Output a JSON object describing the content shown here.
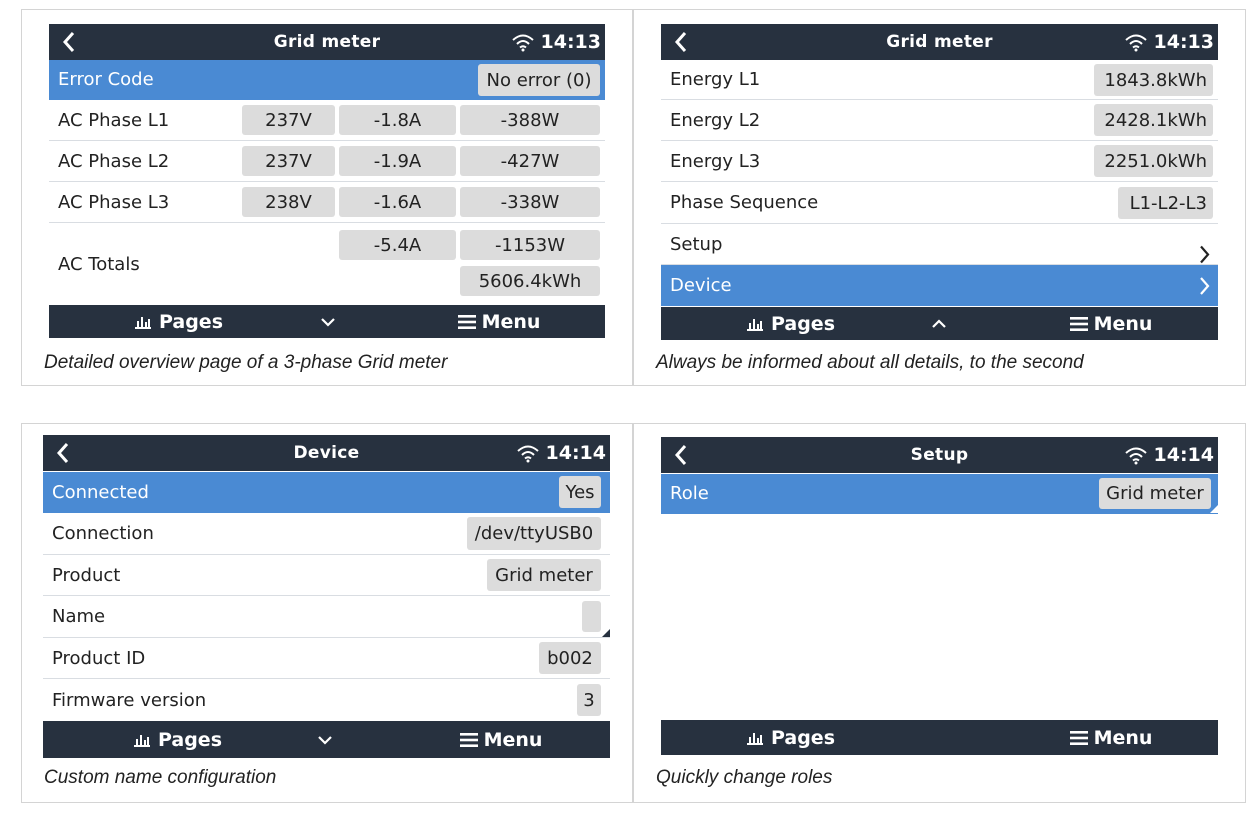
{
  "panels": {
    "p1": {
      "title": "Grid meter",
      "time": "14:13",
      "error": {
        "label": "Error Code",
        "value": "No error (0)"
      },
      "phases": [
        {
          "label": "AC Phase L1",
          "v": "237V",
          "a": "-1.8A",
          "w": "-388W"
        },
        {
          "label": "AC Phase L2",
          "v": "237V",
          "a": "-1.9A",
          "w": "-427W"
        },
        {
          "label": "AC Phase L3",
          "v": "238V",
          "a": "-1.6A",
          "w": "-338W"
        }
      ],
      "totals": {
        "label": "AC Totals",
        "a": "-5.4A",
        "w": "-1153W",
        "kwh": "5606.4kWh"
      },
      "nav": {
        "pages": "Pages",
        "menu": "Menu"
      },
      "caption": "Detailed overview page of a 3-phase Grid meter"
    },
    "p2": {
      "title": "Grid meter",
      "time": "14:13",
      "rows": [
        {
          "label": "Energy L1",
          "value": "1843.8kWh"
        },
        {
          "label": "Energy L2",
          "value": "2428.1kWh"
        },
        {
          "label": "Energy L3",
          "value": "2251.0kWh"
        },
        {
          "label": "Phase Sequence",
          "value": "L1-L2-L3"
        }
      ],
      "setup": "Setup",
      "device": "Device",
      "nav": {
        "pages": "Pages",
        "menu": "Menu"
      },
      "caption": "Always be informed about all details, to the second"
    },
    "p3": {
      "title": "Device",
      "time": "14:14",
      "rows": [
        {
          "label": "Connected",
          "value": "Yes"
        },
        {
          "label": "Connection",
          "value": "/dev/ttyUSB0"
        },
        {
          "label": "Product",
          "value": "Grid meter"
        },
        {
          "label": "Name",
          "value": ""
        },
        {
          "label": "Product ID",
          "value": "b002"
        },
        {
          "label": "Firmware version",
          "value": "3"
        }
      ],
      "nav": {
        "pages": "Pages",
        "menu": "Menu"
      },
      "caption": "Custom name configuration"
    },
    "p4": {
      "title": "Setup",
      "time": "14:14",
      "role": {
        "label": "Role",
        "value": "Grid meter"
      },
      "nav": {
        "pages": "Pages",
        "menu": "Menu"
      },
      "caption": "Quickly change roles"
    }
  },
  "colors": {
    "topbar": "#27313f",
    "selected": "#4a8ad3",
    "chip": "#dcdcdc"
  },
  "icons": [
    "back-chevron-icon",
    "wifi-icon",
    "bars-chart-icon",
    "hamburger-menu-icon",
    "chevron-down-icon",
    "chevron-up-icon",
    "chevron-right-icon"
  ]
}
